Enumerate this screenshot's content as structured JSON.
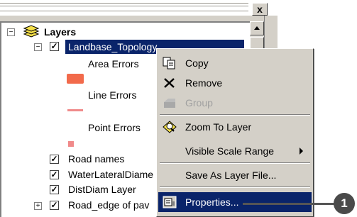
{
  "window": {
    "close_glyph": "x"
  },
  "toc": {
    "root_label": "Layers",
    "root_expander": "⊟",
    "layers": [
      {
        "label": "Landbase_Topology",
        "checked": true,
        "expander": "⊟",
        "selected": true,
        "legend": [
          {
            "label": "Area Errors",
            "symbol": "area"
          },
          {
            "label": "Line Errors",
            "symbol": "line"
          },
          {
            "label": "Point Errors",
            "symbol": "point"
          }
        ]
      },
      {
        "label": "Road names",
        "checked": true
      },
      {
        "label": "WaterLateralDiame",
        "checked": true
      },
      {
        "label": "DistDiam Layer",
        "checked": true
      },
      {
        "label": "Road_edge of pav",
        "checked": true,
        "expander": "⊞"
      }
    ]
  },
  "context_menu": {
    "items": [
      {
        "label": "Copy",
        "icon": "copy-icon",
        "enabled": true
      },
      {
        "label": "Remove",
        "icon": "remove-icon",
        "enabled": true
      },
      {
        "label": "Group",
        "icon": "group-icon",
        "enabled": false
      },
      {
        "label": "Zoom To Layer",
        "icon": "zoom-to-layer-icon",
        "enabled": true
      },
      {
        "label": "Visible Scale Range",
        "icon": "",
        "enabled": true,
        "submenu": true
      },
      {
        "label": "Save As Layer File...",
        "icon": "",
        "enabled": true
      },
      {
        "label": "Properties...",
        "icon": "properties-icon",
        "enabled": true,
        "highlighted": true
      }
    ]
  },
  "callout": {
    "number": "1"
  },
  "colors": {
    "selection": "#0a246a",
    "area_error": "#f26a4b",
    "line_error": "#f08a8a",
    "point_error": "#f08a8a"
  }
}
